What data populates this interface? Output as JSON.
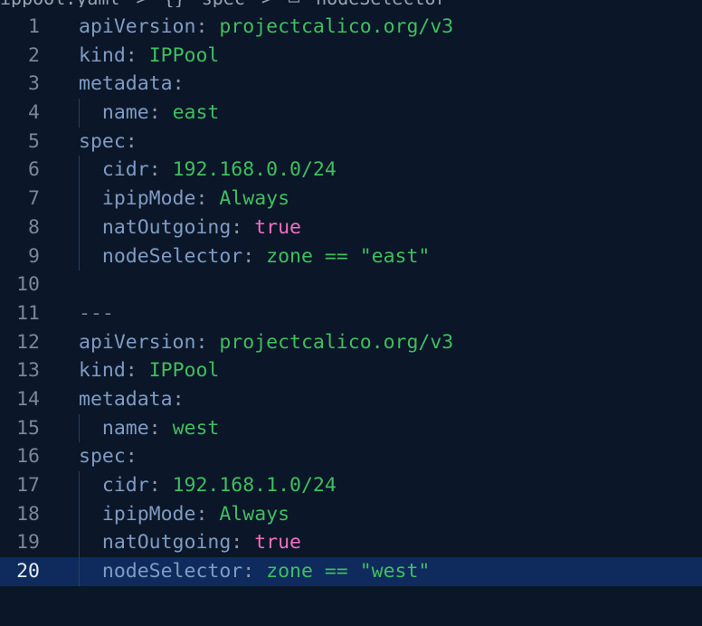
{
  "breadcrumb": {
    "file": "ippool.yaml",
    "sep1": ">",
    "spec_icon": "{}",
    "spec": "spec",
    "sep2": ">",
    "node_icon": "▭",
    "node": "nodeSelector"
  },
  "colors": {
    "background": "#0b1628",
    "key": "#7f9cc4",
    "string": "#3fbf5f",
    "boolean": "#f06fc1",
    "active_line": "#0f2a5c"
  },
  "editor": {
    "active_line": 20,
    "lines": [
      {
        "num": "1",
        "indent": "",
        "key": "apiVersion",
        "colon": ":",
        "value": "projectcalico.org/v3"
      },
      {
        "num": "2",
        "indent": "",
        "key": "kind",
        "colon": ":",
        "value": "IPPool"
      },
      {
        "num": "3",
        "indent": "",
        "key": "metadata",
        "colon": ":",
        "value": ""
      },
      {
        "num": "4",
        "indent": "  ",
        "key": "name",
        "colon": ":",
        "value": "east"
      },
      {
        "num": "5",
        "indent": "",
        "key": "spec",
        "colon": ":",
        "value": ""
      },
      {
        "num": "6",
        "indent": "  ",
        "key": "cidr",
        "colon": ":",
        "value": "192.168.0.0/24"
      },
      {
        "num": "7",
        "indent": "  ",
        "key": "ipipMode",
        "colon": ":",
        "value": "Always"
      },
      {
        "num": "8",
        "indent": "  ",
        "key": "natOutgoing",
        "colon": ":",
        "value": "true"
      },
      {
        "num": "9",
        "indent": "  ",
        "key": "nodeSelector",
        "colon": ":",
        "value": "zone == \"east\""
      },
      {
        "num": "10",
        "indent": "",
        "key": "",
        "colon": "",
        "value": ""
      },
      {
        "num": "11",
        "indent": "",
        "key": "",
        "colon": "",
        "value": "---"
      },
      {
        "num": "12",
        "indent": "",
        "key": "apiVersion",
        "colon": ":",
        "value": "projectcalico.org/v3"
      },
      {
        "num": "13",
        "indent": "",
        "key": "kind",
        "colon": ":",
        "value": "IPPool"
      },
      {
        "num": "14",
        "indent": "",
        "key": "metadata",
        "colon": ":",
        "value": ""
      },
      {
        "num": "15",
        "indent": "  ",
        "key": "name",
        "colon": ":",
        "value": "west"
      },
      {
        "num": "16",
        "indent": "",
        "key": "spec",
        "colon": ":",
        "value": ""
      },
      {
        "num": "17",
        "indent": "  ",
        "key": "cidr",
        "colon": ":",
        "value": "192.168.1.0/24"
      },
      {
        "num": "18",
        "indent": "  ",
        "key": "ipipMode",
        "colon": ":",
        "value": "Always"
      },
      {
        "num": "19",
        "indent": "  ",
        "key": "natOutgoing",
        "colon": ":",
        "value": "true"
      },
      {
        "num": "20",
        "indent": "  ",
        "key": "nodeSelector",
        "colon": ":",
        "value": "zone == \"west\""
      }
    ]
  }
}
